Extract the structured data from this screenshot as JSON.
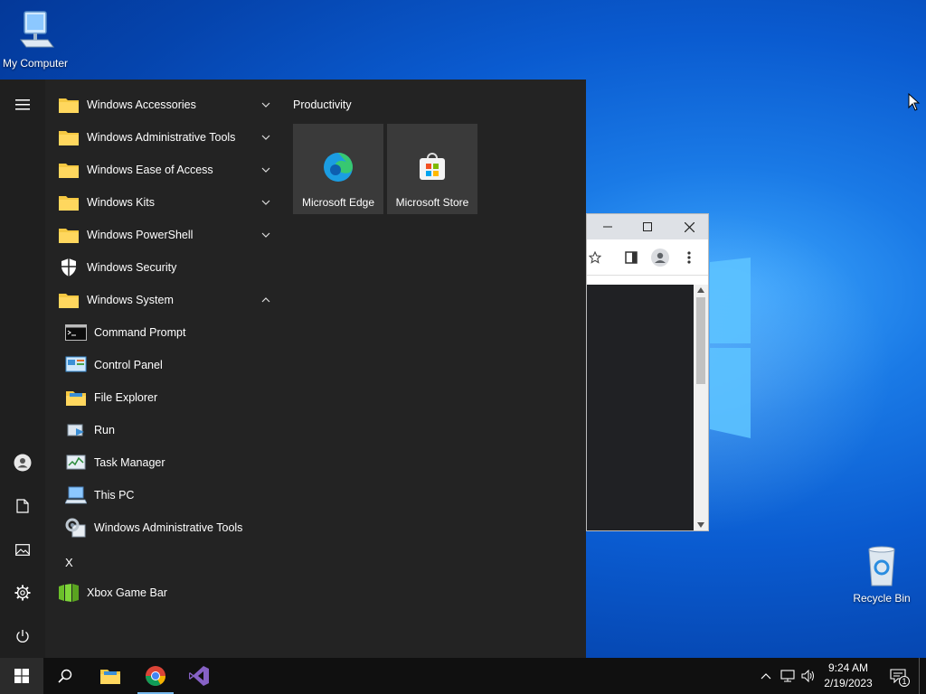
{
  "desktop": {
    "icons": [
      {
        "label": "My Computer",
        "icon": "computer-icon"
      },
      {
        "label": "Recycle Bin",
        "icon": "recycle-bin-icon"
      }
    ]
  },
  "start_menu": {
    "rail": {
      "items": [
        {
          "icon": "hamburger-menu-icon"
        },
        {
          "icon": "user-icon"
        },
        {
          "icon": "documents-icon"
        },
        {
          "icon": "pictures-icon"
        },
        {
          "icon": "settings-gear-icon"
        },
        {
          "icon": "power-icon"
        }
      ]
    },
    "apps": [
      {
        "label": "Windows Accessories",
        "icon": "folder-icon",
        "chevron": "down"
      },
      {
        "label": "Windows Administrative Tools",
        "icon": "folder-icon",
        "chevron": "down"
      },
      {
        "label": "Windows Ease of Access",
        "icon": "folder-icon",
        "chevron": "down"
      },
      {
        "label": "Windows Kits",
        "icon": "folder-icon",
        "chevron": "down"
      },
      {
        "label": "Windows PowerShell",
        "icon": "folder-icon",
        "chevron": "down"
      },
      {
        "label": "Windows Security",
        "icon": "shield-icon"
      },
      {
        "label": "Windows System",
        "icon": "folder-icon",
        "chevron": "up"
      },
      {
        "label": "Command Prompt",
        "icon": "command-prompt-icon"
      },
      {
        "label": "Control Panel",
        "icon": "control-panel-icon"
      },
      {
        "label": "File Explorer",
        "icon": "file-explorer-icon"
      },
      {
        "label": "Run",
        "icon": "run-icon"
      },
      {
        "label": "Task Manager",
        "icon": "task-manager-icon"
      },
      {
        "label": "This PC",
        "icon": "this-pc-icon"
      },
      {
        "label": "Windows Administrative Tools",
        "icon": "admin-tools-icon"
      }
    ],
    "letter_x": "X",
    "xbox": {
      "label": "Xbox Game Bar",
      "icon": "xbox-game-bar-icon"
    },
    "tiles": {
      "group_title": "Productivity",
      "items": [
        {
          "label": "Microsoft Edge",
          "icon": "edge-icon"
        },
        {
          "label": "Microsoft Store",
          "icon": "store-icon"
        }
      ]
    }
  },
  "browser": {
    "controls": [
      "minimize-icon",
      "maximize-icon",
      "close-icon"
    ],
    "toolbar": [
      "bookmark-star-icon",
      "side-panel-icon",
      "profile-icon",
      "more-menu-icon"
    ]
  },
  "taskbar": {
    "items": [
      {
        "icon": "windows-start-icon"
      },
      {
        "icon": "search-icon"
      },
      {
        "icon": "file-explorer-icon"
      },
      {
        "icon": "chrome-icon"
      },
      {
        "icon": "visual-studio-icon"
      }
    ],
    "tray": {
      "time": "9:24 AM",
      "date": "2/19/2023",
      "notification_count": "1"
    }
  },
  "colors": {
    "start_bg": "#232323",
    "taskbar_bg": "#101010",
    "tile_bg": "#3a3a3a",
    "accent": "#76b9ed",
    "folder": "#f5c842"
  }
}
